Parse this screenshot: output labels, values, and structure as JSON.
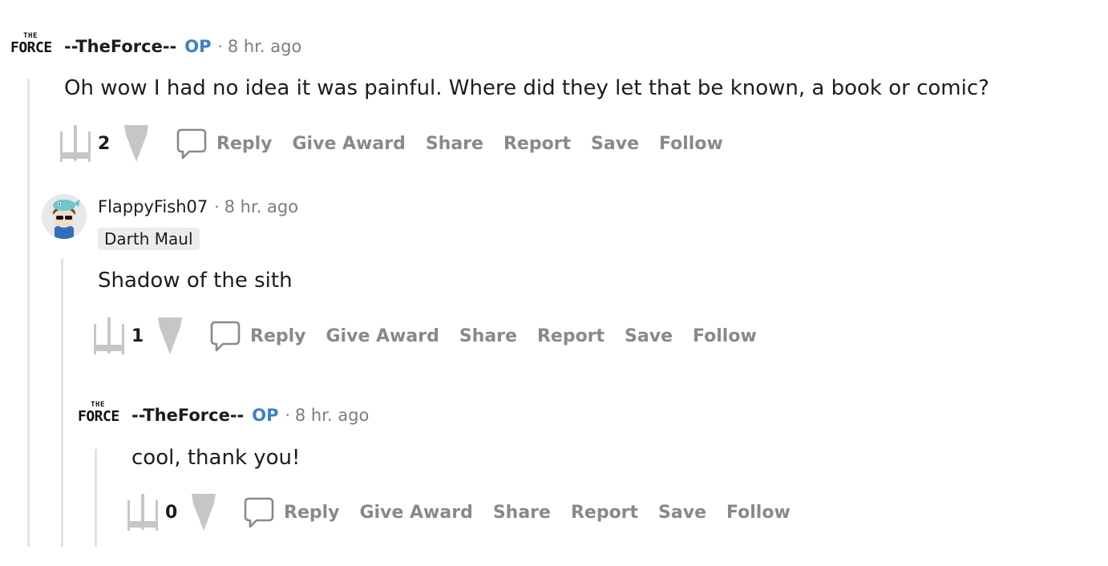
{
  "icons": {
    "upvote": "x-wing-upvote-icon",
    "downvote": "star-destroyer-downvote-icon",
    "reply": "speech-bubble-icon"
  },
  "colors": {
    "op": "#3b7fd0",
    "action_text": "#878a8c",
    "thread_line": "#e3e3e3",
    "flair_bg": "#ececec"
  },
  "logo": {
    "the": "THE",
    "force": "FORCE"
  },
  "actions": {
    "reply": "Reply",
    "give_award": "Give Award",
    "share": "Share",
    "report": "Report",
    "save": "Save",
    "follow": "Follow"
  },
  "comments": [
    {
      "author": "--TheForce--",
      "op_label": "OP",
      "separator": "·",
      "time": "8 hr. ago",
      "body": "Oh wow I had no idea it was painful. Where did they let that be known, a book or comic?",
      "score": "2"
    },
    {
      "author": "FlappyFish07",
      "separator": "·",
      "time": "8 hr. ago",
      "flair": "Darth Maul",
      "body": "Shadow of the sith",
      "score": "1"
    },
    {
      "author": "--TheForce--",
      "op_label": "OP",
      "separator": "·",
      "time": "8 hr. ago",
      "body": "cool, thank you!",
      "score": "0"
    }
  ]
}
